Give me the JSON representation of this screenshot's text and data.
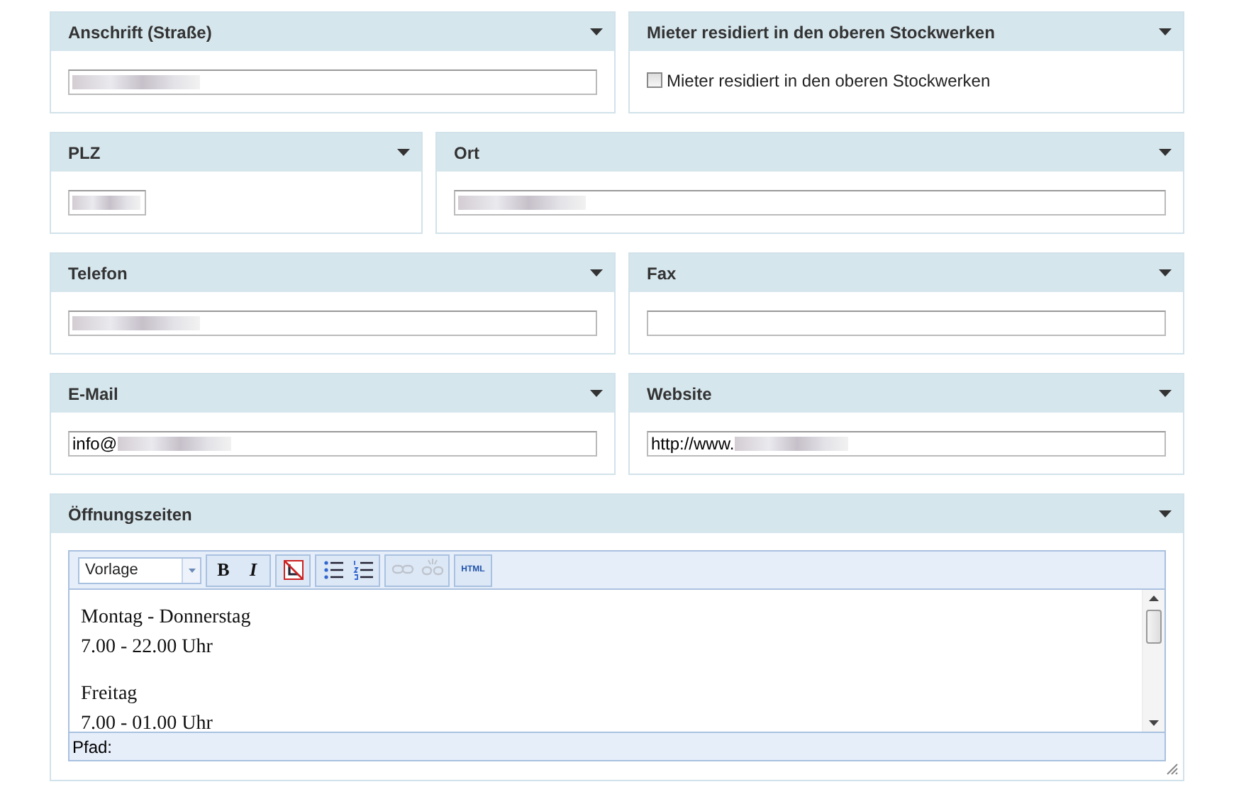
{
  "rows": [
    {
      "kind": "halves",
      "panels": [
        {
          "title": "Anschrift (Straße)",
          "field": {
            "kind": "text",
            "redacted": true
          }
        },
        {
          "title": "Mieter residiert in den oberen Stockwerken",
          "field": {
            "kind": "checkbox",
            "label": "Mieter residiert in den oberen Stockwerken",
            "checked": false
          }
        }
      ]
    },
    {
      "kind": "narrow-wide",
      "panels": [
        {
          "title": "PLZ",
          "field": {
            "kind": "short_text",
            "redacted": true
          }
        },
        {
          "title": "Ort",
          "field": {
            "kind": "text",
            "redacted": true
          }
        }
      ]
    },
    {
      "kind": "halves",
      "panels": [
        {
          "title": "Telefon",
          "field": {
            "kind": "text",
            "redacted": true
          }
        },
        {
          "title": "Fax",
          "field": {
            "kind": "text",
            "redacted": false
          }
        }
      ]
    },
    {
      "kind": "halves",
      "panels": [
        {
          "title": "E-Mail",
          "field": {
            "kind": "text",
            "value": "info@",
            "redacted": true
          }
        },
        {
          "title": "Website",
          "field": {
            "kind": "text",
            "value": "http://www.",
            "redacted": true
          }
        }
      ]
    },
    {
      "kind": "full",
      "panels": [
        {
          "title": "Öffnungszeiten",
          "field": {
            "kind": "editor",
            "format": "Vorlage",
            "tools": [
              {
                "kind": "bold",
                "label": "B",
                "disabled": false
              },
              {
                "kind": "italic",
                "label": "I",
                "disabled": false
              },
              {
                "kind": "clear",
                "disabled": false
              },
              {
                "kind": "bullets",
                "disabled": false
              },
              {
                "kind": "numbers",
                "disabled": false
              },
              {
                "kind": "link",
                "disabled": true
              },
              {
                "kind": "unlink",
                "disabled": true
              },
              {
                "kind": "html",
                "label": "HTML",
                "disabled": false
              }
            ],
            "paragraphs": [
              [
                "Montag - Donnerstag",
                "7.00 - 22.00 Uhr"
              ],
              [
                "Freitag",
                "7.00 - 01.00 Uhr"
              ]
            ],
            "path_label": "Pfad:"
          }
        }
      ]
    }
  ]
}
